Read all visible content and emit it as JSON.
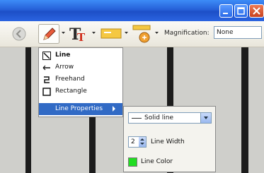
{
  "toolbar": {
    "magnification_label": "Magnification:",
    "magnification_value": "None"
  },
  "menu": {
    "items": [
      {
        "label": "Line",
        "icon": "line-icon",
        "bold": true
      },
      {
        "label": "Arrow",
        "icon": "arrow-icon"
      },
      {
        "label": "Freehand",
        "icon": "freehand-icon"
      },
      {
        "label": "Rectangle",
        "icon": "rectangle-icon"
      },
      {
        "label": "Line Properties",
        "icon": "",
        "selected": true
      }
    ]
  },
  "line_properties": {
    "style_value": "Solid line",
    "width_value": "2",
    "width_label": "Line Width",
    "color_label": "Line Color",
    "color": "#22dd22"
  },
  "colors": {
    "selection": "#316ac5",
    "titlebar": "#2660d8"
  }
}
